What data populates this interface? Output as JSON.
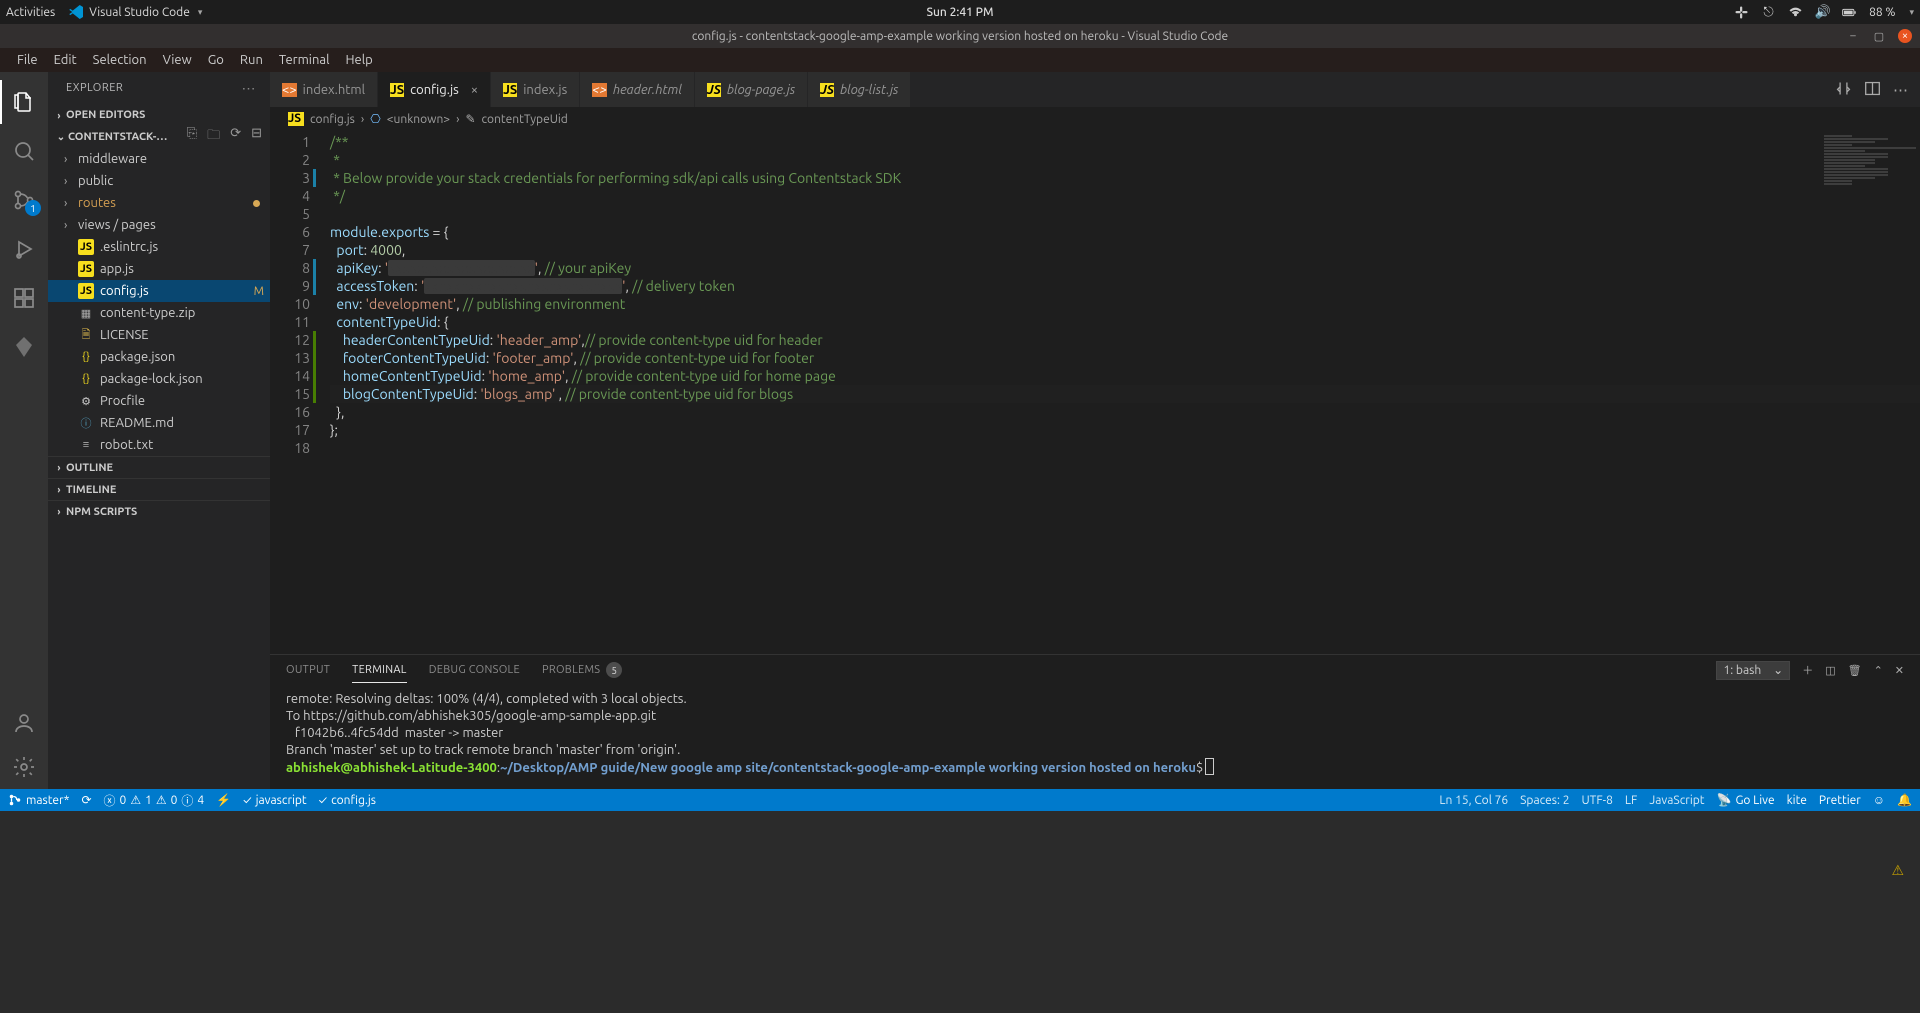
{
  "os": {
    "activities": "Activities",
    "app": "Visual Studio Code",
    "time": "Sun  2:41 PM",
    "battery": "88 %"
  },
  "window": {
    "title": "config.js - contentstack-google-amp-example working version hosted on heroku - Visual Studio Code"
  },
  "menu": [
    "File",
    "Edit",
    "Selection",
    "View",
    "Go",
    "Run",
    "Terminal",
    "Help"
  ],
  "sidebar": {
    "title": "EXPLORER",
    "open_editors": "OPEN EDITORS",
    "project": "CONTENTSTACK-…",
    "outline": "OUTLINE",
    "timeline": "TIMELINE",
    "npm": "NPM SCRIPTS",
    "tree": [
      {
        "type": "folder",
        "label": "middleware"
      },
      {
        "type": "folder",
        "label": "public"
      },
      {
        "type": "folder",
        "label": "routes",
        "git": "dot"
      },
      {
        "type": "folder",
        "label": "views / pages"
      },
      {
        "type": "file",
        "label": ".eslintrc.js",
        "icon": "js"
      },
      {
        "type": "file",
        "label": "app.js",
        "icon": "js"
      },
      {
        "type": "file",
        "label": "config.js",
        "icon": "js",
        "selected": true,
        "git": "M"
      },
      {
        "type": "file",
        "label": "content-type.zip",
        "icon": "zip"
      },
      {
        "type": "file",
        "label": "LICENSE",
        "icon": "lic"
      },
      {
        "type": "file",
        "label": "package.json",
        "icon": "json"
      },
      {
        "type": "file",
        "label": "package-lock.json",
        "icon": "json"
      },
      {
        "type": "file",
        "label": "Procfile",
        "icon": "grey"
      },
      {
        "type": "file",
        "label": "README.md",
        "icon": "md"
      },
      {
        "type": "file",
        "label": "robot.txt",
        "icon": "txt"
      }
    ]
  },
  "tabs": [
    {
      "label": "index.html",
      "icon": "orange"
    },
    {
      "label": "config.js",
      "icon": "js",
      "active": true,
      "close": true
    },
    {
      "label": "index.js",
      "icon": "js"
    },
    {
      "label": "header.html",
      "icon": "orange",
      "italic": true
    },
    {
      "label": "blog-page.js",
      "icon": "js",
      "italic": true
    },
    {
      "label": "blog-list.js",
      "icon": "js",
      "italic": true
    }
  ],
  "breadcrumb": {
    "ic1": "JS",
    "file": "config.js",
    "sep": "›",
    "seg1": "<unknown>",
    "seg2": "contentTypeUid"
  },
  "code": {
    "lines": [
      {
        "t": "cm",
        "s": "/**"
      },
      {
        "t": "cm",
        "s": " *"
      },
      {
        "t": "cm",
        "s": " * Below provide your stack credentials for performing sdk/api calls using Contentstack SDK",
        "mod": true
      },
      {
        "t": "cm",
        "s": " */"
      },
      {
        "t": "bl",
        "s": ""
      },
      {
        "t": "rw",
        "parts": [
          {
            "c": "prop",
            "s": "module"
          },
          {
            "c": "pun",
            "s": "."
          },
          {
            "c": "prop",
            "s": "exports"
          },
          {
            "c": "pun",
            "s": " = {"
          }
        ]
      },
      {
        "t": "rw",
        "parts": [
          {
            "c": "pun",
            "s": "  "
          },
          {
            "c": "prop",
            "s": "port"
          },
          {
            "c": "pun",
            "s": ": "
          },
          {
            "c": "num",
            "s": "4000"
          },
          {
            "c": "pun",
            "s": ","
          }
        ]
      },
      {
        "t": "rw",
        "parts": [
          {
            "c": "pun",
            "s": "  "
          },
          {
            "c": "prop",
            "s": "apiKey"
          },
          {
            "c": "pun",
            "s": ": "
          },
          {
            "c": "str",
            "s": "'"
          },
          {
            "c": "redact",
            "s": "xxxxxxxxxxxxxxxxxxxx"
          },
          {
            "c": "str",
            "s": "'"
          },
          {
            "c": "pun",
            "s": ", "
          },
          {
            "c": "cmt",
            "s": "// your apiKey"
          }
        ],
        "mod": true
      },
      {
        "t": "rw",
        "parts": [
          {
            "c": "pun",
            "s": "  "
          },
          {
            "c": "prop",
            "s": "accessToken"
          },
          {
            "c": "pun",
            "s": ": "
          },
          {
            "c": "str",
            "s": "'"
          },
          {
            "c": "redact",
            "s": "xxxxxxxxxxxxxxxxxxxxxxxxxxx"
          },
          {
            "c": "str",
            "s": "'"
          },
          {
            "c": "pun",
            "s": ", "
          },
          {
            "c": "cmt",
            "s": "// delivery token"
          }
        ],
        "mod": true
      },
      {
        "t": "rw",
        "parts": [
          {
            "c": "pun",
            "s": "  "
          },
          {
            "c": "prop",
            "s": "env"
          },
          {
            "c": "pun",
            "s": ": "
          },
          {
            "c": "str",
            "s": "'development'"
          },
          {
            "c": "pun",
            "s": ", "
          },
          {
            "c": "cmt",
            "s": "// publishing environment"
          }
        ]
      },
      {
        "t": "rw",
        "parts": [
          {
            "c": "pun",
            "s": "  "
          },
          {
            "c": "prop",
            "s": "contentTypeUid"
          },
          {
            "c": "pun",
            "s": ": {"
          }
        ]
      },
      {
        "t": "rw",
        "parts": [
          {
            "c": "pun",
            "s": "    "
          },
          {
            "c": "prop",
            "s": "headerContentTypeUid"
          },
          {
            "c": "pun",
            "s": ": "
          },
          {
            "c": "str",
            "s": "'header_amp'"
          },
          {
            "c": "pun",
            "s": ","
          },
          {
            "c": "cmt",
            "s": "// provide content-type uid for header"
          }
        ],
        "modg": true
      },
      {
        "t": "rw",
        "parts": [
          {
            "c": "pun",
            "s": "    "
          },
          {
            "c": "prop",
            "s": "footerContentTypeUid"
          },
          {
            "c": "pun",
            "s": ": "
          },
          {
            "c": "str",
            "s": "'footer_amp'"
          },
          {
            "c": "pun",
            "s": ", "
          },
          {
            "c": "cmt",
            "s": "// provide content-type uid for footer"
          }
        ],
        "modg": true
      },
      {
        "t": "rw",
        "parts": [
          {
            "c": "pun",
            "s": "    "
          },
          {
            "c": "prop",
            "s": "homeContentTypeUid"
          },
          {
            "c": "pun",
            "s": ": "
          },
          {
            "c": "str",
            "s": "'home_amp'"
          },
          {
            "c": "pun",
            "s": ", "
          },
          {
            "c": "cmt",
            "s": "// provide content-type uid for home page"
          }
        ],
        "modg": true
      },
      {
        "t": "rw",
        "parts": [
          {
            "c": "pun",
            "s": "    "
          },
          {
            "c": "prop",
            "s": "blogContentTypeUid"
          },
          {
            "c": "pun",
            "s": ": "
          },
          {
            "c": "str",
            "s": "'blogs_amp'"
          },
          {
            "c": "pun",
            "s": " , "
          },
          {
            "c": "cmt",
            "s": "// provide content-type uid for blogs"
          }
        ],
        "modg": true,
        "active": true
      },
      {
        "t": "rw",
        "parts": [
          {
            "c": "pun",
            "s": "  },"
          }
        ]
      },
      {
        "t": "rw",
        "parts": [
          {
            "c": "pun",
            "s": "};"
          }
        ]
      },
      {
        "t": "bl",
        "s": ""
      }
    ]
  },
  "panel": {
    "tabs": {
      "output": "OUTPUT",
      "terminal": "TERMINAL",
      "debug": "DEBUG CONSOLE",
      "problems": "PROBLEMS",
      "problem_count": "5"
    },
    "shell": "1: bash",
    "lines": [
      "remote: Resolving deltas: 100% (4/4), completed with 3 local objects.",
      "To https://github.com/abhishek305/google-amp-sample-app.git",
      "   f1042b6..4fc54dd  master -> master",
      "Branch 'master' set up to track remote branch 'master' from 'origin'."
    ],
    "prompt_user": "abhishek@abhishek-Latitude-3400",
    "prompt_sep": ":",
    "prompt_path": "~/Desktop/AMP guide/New google amp site/contentstack-google-amp-example working version hosted on heroku",
    "prompt_end": "$ "
  },
  "status": {
    "branch": "master*",
    "errors": "0",
    "warns_a": "1",
    "warns_b": "0",
    "info": "4",
    "lang_chk": "javascript",
    "file_chk": "config.js",
    "pos": "Ln 15, Col 76",
    "spaces": "Spaces: 2",
    "enc": "UTF-8",
    "eol": "LF",
    "lang": "JavaScript",
    "golive": "Go Live",
    "kite": "kite",
    "prettier": "Prettier"
  },
  "scm_badge": "1"
}
